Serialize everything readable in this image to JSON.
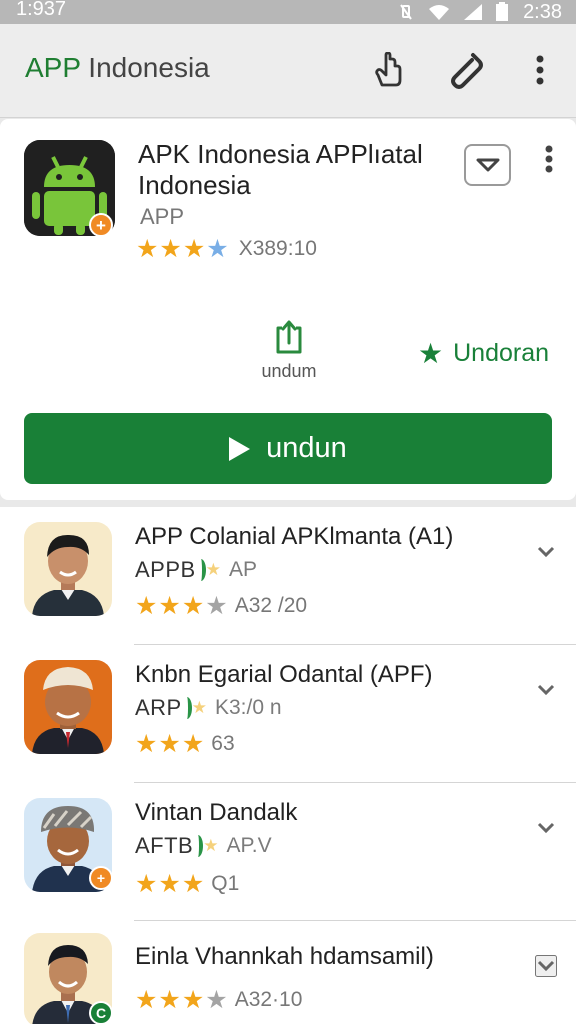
{
  "status_bar": {
    "time": "1:937",
    "clock": "2:38"
  },
  "app_bar": {
    "title_brand": "APP",
    "title_rest": " Indonesia",
    "accent_color": "#1f7e32",
    "icons": [
      "share-hand-icon",
      "attachment-icon",
      "more-vert-icon"
    ]
  },
  "app_detail": {
    "title": "APK Indonesia APPlıatal Indonesia",
    "subtitle": "APP",
    "rating_count": "X389:10",
    "stars": 3,
    "share_label": "undum",
    "wishlist_label": "Undoran",
    "install_label": "undun",
    "install_color": "#198037"
  },
  "list": {
    "items": [
      {
        "title": "APP Colanial APKlmanta (A1)",
        "publisher_code": "APPB",
        "publisher_meta": "AP",
        "rating_text": "A32 /20",
        "stars": 3,
        "avatar_badge": ""
      },
      {
        "title": "Knbn Egarial Odantal (APF)",
        "publisher_code": "ARP",
        "publisher_meta": "K3:/0 n",
        "rating_text": "63",
        "stars": 3,
        "avatar_badge": ""
      },
      {
        "title": "Vintan Dandalk",
        "publisher_code": "AFTB",
        "publisher_meta": "AP.V",
        "rating_text": "Q1",
        "stars": 3,
        "avatar_badge": "+"
      },
      {
        "title": "Einla Vhannkah hdamsamil)",
        "publisher_code": "",
        "publisher_meta": "",
        "rating_text": "A32·10",
        "stars": 3,
        "avatar_badge": "C"
      }
    ]
  }
}
